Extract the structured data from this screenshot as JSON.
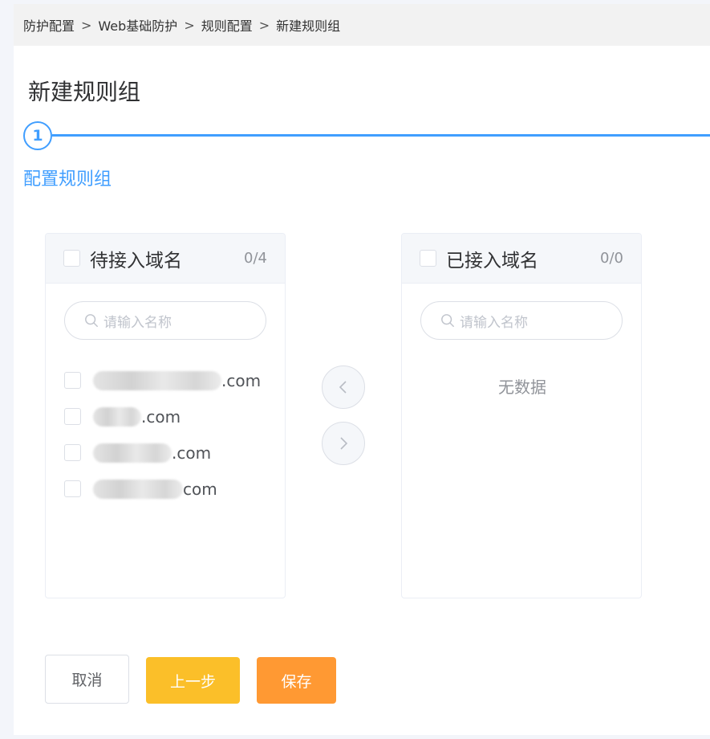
{
  "breadcrumb": {
    "items": [
      "防护配置",
      "Web基础防护",
      "规则配置",
      "新建规则组"
    ],
    "separator": ">"
  },
  "page": {
    "title": "新建规则组"
  },
  "steps": [
    {
      "number": "1",
      "label": "配置规则组",
      "active": true
    }
  ],
  "transfer": {
    "left": {
      "title": "待接入域名",
      "count": "0/4",
      "search_placeholder": "请输入名称",
      "items": [
        {
          "suffix": ".com",
          "redacted": true
        },
        {
          "suffix": ".com",
          "redacted": true
        },
        {
          "suffix": ".com",
          "redacted": true
        },
        {
          "suffix": "com",
          "redacted": true
        }
      ]
    },
    "right": {
      "title": "已接入域名",
      "count": "0/0",
      "search_placeholder": "请输入名称",
      "empty_text": "无数据"
    }
  },
  "actions": {
    "cancel_label": "取消",
    "prev_label": "上一步",
    "save_label": "保存"
  },
  "colors": {
    "primary": "#409eff",
    "prev_button": "#fbbf29",
    "save_button": "#ff9933"
  }
}
